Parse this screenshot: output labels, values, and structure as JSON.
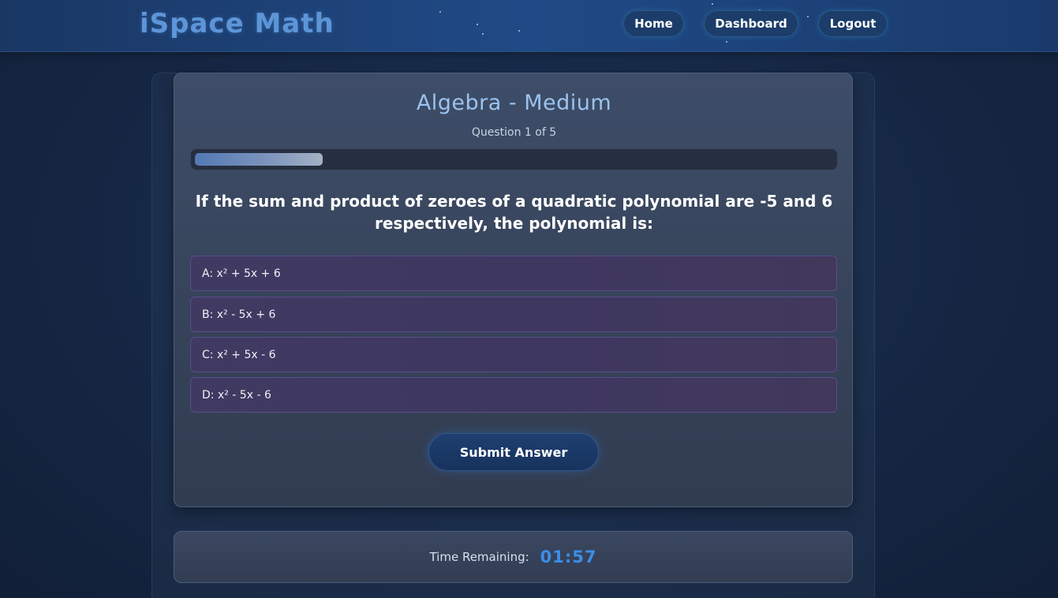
{
  "header": {
    "logo": "iSpace Math",
    "nav": [
      {
        "label": "Home"
      },
      {
        "label": "Dashboard"
      },
      {
        "label": "Logout"
      }
    ]
  },
  "quiz": {
    "title": "Algebra - Medium",
    "progress_text": "Question 1 of 5",
    "progress_fraction": 0.2,
    "question": "If the sum and product of zeroes of a quadratic polynomial are -5 and 6 respectively, the polynomial is:",
    "options": [
      {
        "label": "A: x² + 5x + 6"
      },
      {
        "label": "B: x² - 5x + 6"
      },
      {
        "label": "C: x² + 5x - 6"
      },
      {
        "label": "D: x² - 5x - 6"
      }
    ],
    "submit_label": "Submit Answer"
  },
  "timer": {
    "label": "Time Remaining:",
    "value": "01:57"
  },
  "colors": {
    "accent": "#3c8ee8",
    "title": "#9cc3ee",
    "logo": "#5d95d8",
    "option_bg": "#403a62"
  }
}
